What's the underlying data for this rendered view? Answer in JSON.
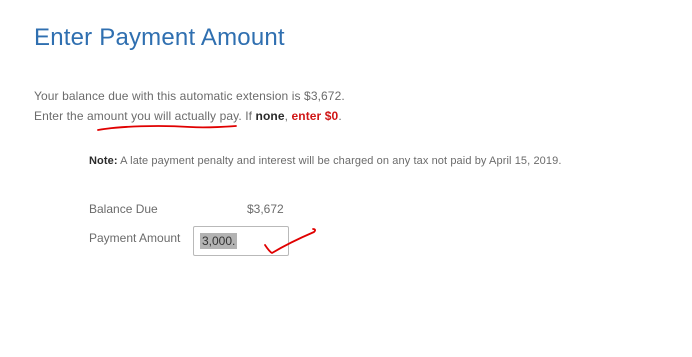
{
  "page": {
    "title": "Enter Payment Amount"
  },
  "intro": {
    "line1": "Your balance due with this automatic extension is $3,672.",
    "line2_prefix": "Enter the amount you will actually pay. If ",
    "line2_none": "none",
    "line2_comma": ", ",
    "line2_enter": "enter $0",
    "line2_period": "."
  },
  "note": {
    "label": "Note:",
    "text": " A late payment penalty and interest will be charged on any tax not paid by April 15, 2019."
  },
  "balance_due": {
    "label": "Balance Due",
    "value": "$3,672"
  },
  "payment_amount": {
    "label": "Payment Amount",
    "value": "3,000."
  },
  "colors": {
    "title": "#2f6fb0",
    "emphasis_red": "#d01616",
    "annotation_red": "#e00000",
    "body_text": "#6b6b6b"
  }
}
